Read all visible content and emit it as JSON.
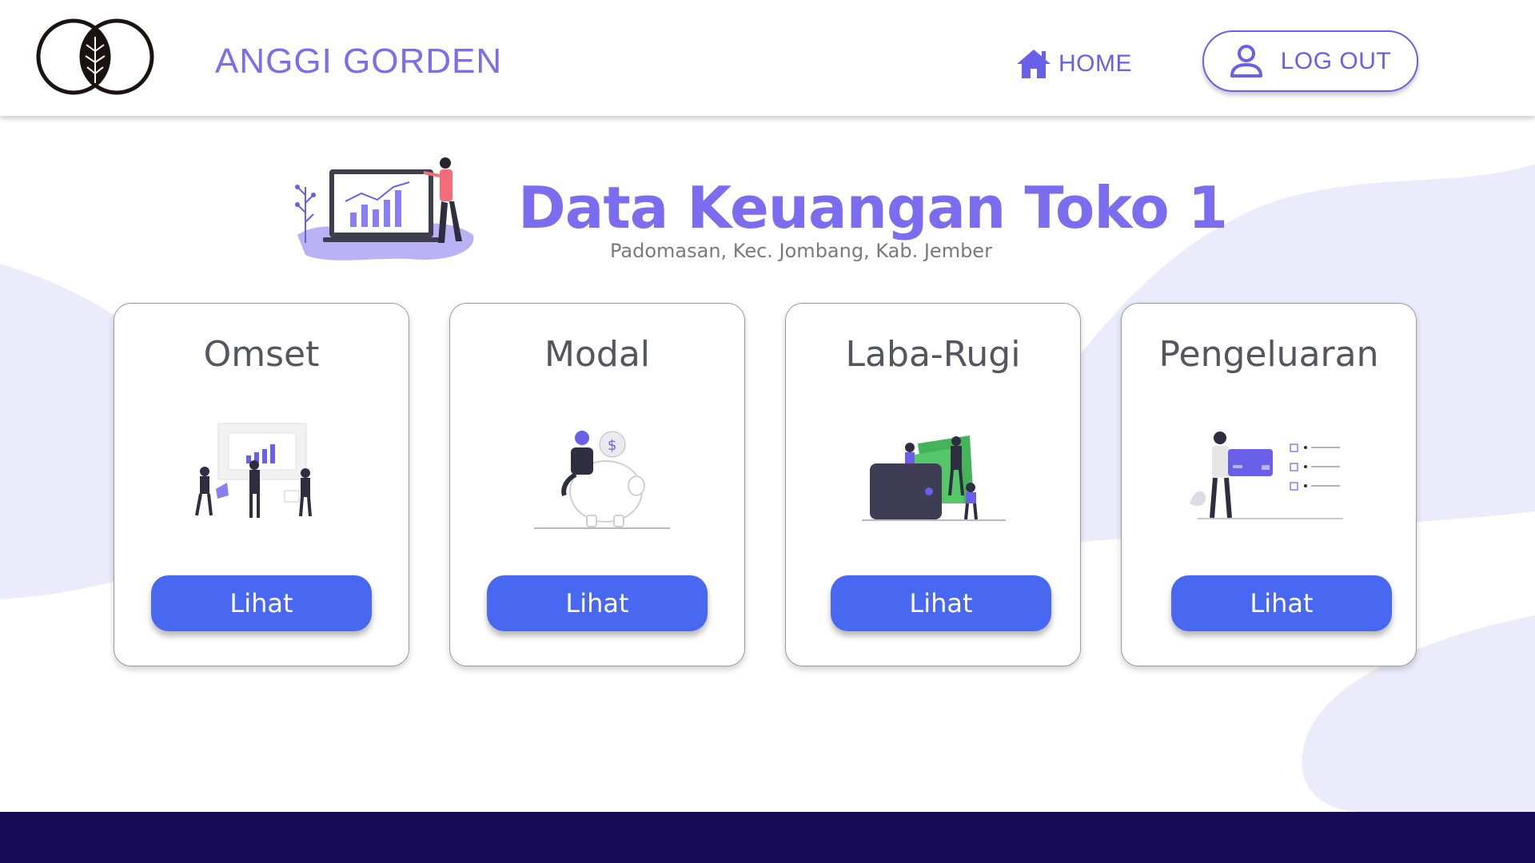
{
  "header": {
    "brand": "ANGGI GORDEN",
    "nav_home": "HOME",
    "logout": "LOG OUT"
  },
  "hero": {
    "title": "Data Keuangan Toko 1",
    "subtitle": "Padomasan, Kec. Jombang, Kab. Jember"
  },
  "cards": [
    {
      "title": "Omset",
      "button": "Lihat",
      "icon": "revenue-chart-icon"
    },
    {
      "title": "Modal",
      "button": "Lihat",
      "icon": "piggy-bank-icon"
    },
    {
      "title": "Laba-Rugi",
      "button": "Lihat",
      "icon": "wallet-money-icon"
    },
    {
      "title": "Pengeluaran",
      "button": "Lihat",
      "icon": "credit-card-checklist-icon"
    }
  ],
  "colors": {
    "accent": "#7b6cf0",
    "button": "#4868f2",
    "footer": "#170b57",
    "blob": "#ecebfb"
  }
}
